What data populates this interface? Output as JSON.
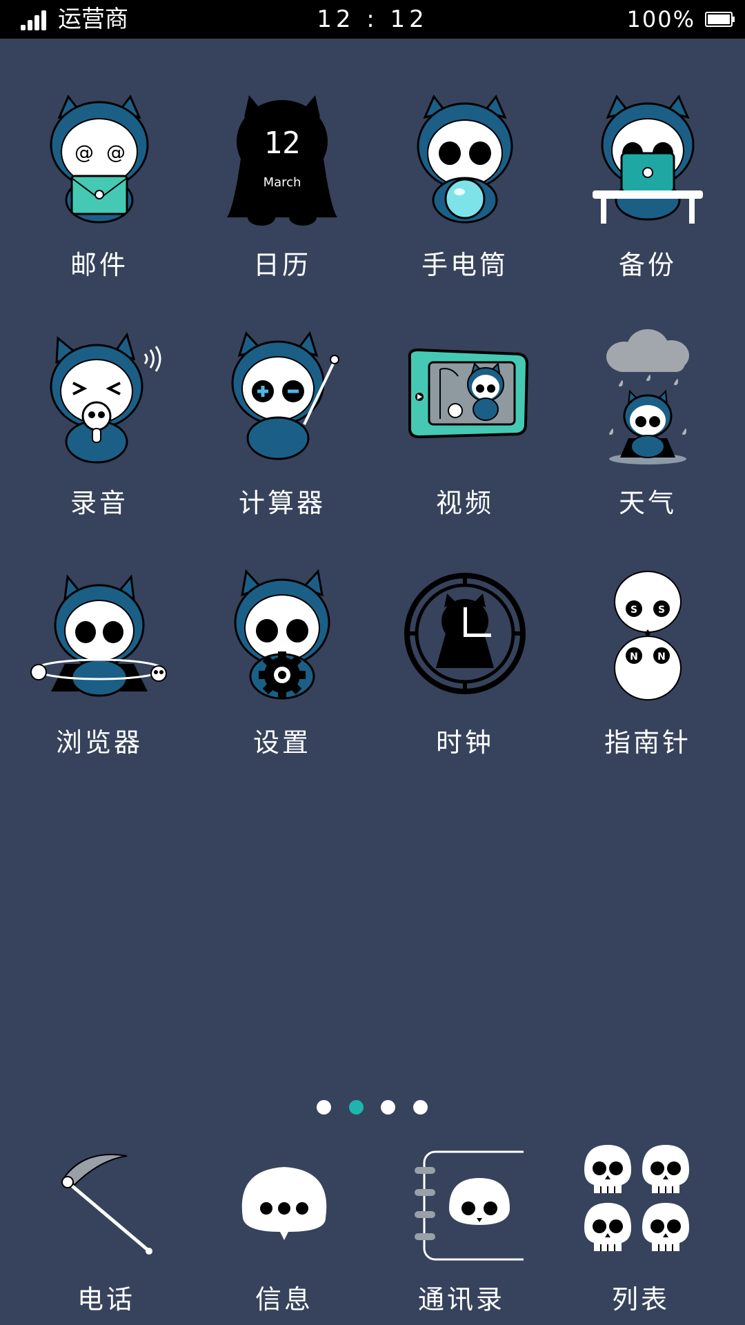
{
  "status_bar": {
    "carrier": "运营商",
    "time": "12 : 12",
    "battery": "100%"
  },
  "calendar_icon": {
    "day": "12",
    "month": "March"
  },
  "apps": [
    {
      "label": "邮件",
      "icon": "mail-icon"
    },
    {
      "label": "日历",
      "icon": "calendar-icon"
    },
    {
      "label": "手电筒",
      "icon": "flashlight-icon"
    },
    {
      "label": "备份",
      "icon": "backup-icon"
    },
    {
      "label": "录音",
      "icon": "recorder-icon"
    },
    {
      "label": "计算器",
      "icon": "calculator-icon"
    },
    {
      "label": "视频",
      "icon": "video-icon"
    },
    {
      "label": "天气",
      "icon": "weather-icon"
    },
    {
      "label": "浏览器",
      "icon": "browser-icon"
    },
    {
      "label": "设置",
      "icon": "settings-icon"
    },
    {
      "label": "时钟",
      "icon": "clock-icon"
    },
    {
      "label": "指南针",
      "icon": "compass-icon"
    }
  ],
  "page_indicator": {
    "pages": 4,
    "active": 2
  },
  "dock": [
    {
      "label": "电话",
      "icon": "phone-scythe-icon"
    },
    {
      "label": "信息",
      "icon": "message-icon"
    },
    {
      "label": "通讯录",
      "icon": "contacts-icon"
    },
    {
      "label": "列表",
      "icon": "app-list-icon"
    }
  ],
  "colors": {
    "background": "#37435c",
    "status_bar": "#000000",
    "hood_blue": "#1b5f86",
    "teal": "#45c9b4",
    "active_dot": "#1fb5ad"
  }
}
